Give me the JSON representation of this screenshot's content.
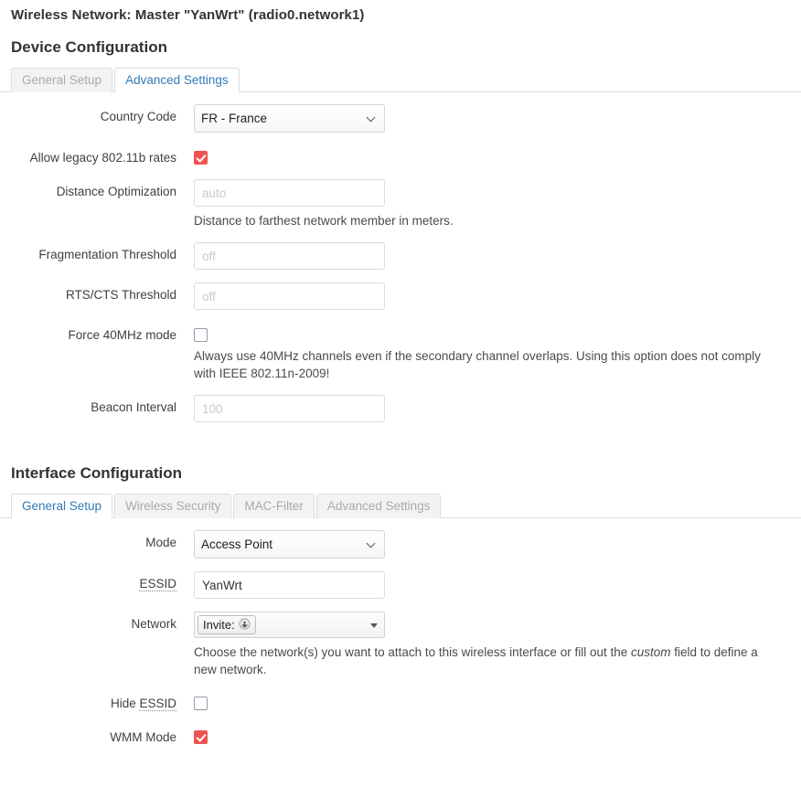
{
  "page": {
    "title": "Wireless Network: Master \"YanWrt\" (radio0.network1)"
  },
  "device_section": {
    "heading": "Device Configuration",
    "tabs": [
      {
        "label": "General Setup",
        "active": false
      },
      {
        "label": "Advanced Settings",
        "active": true
      }
    ],
    "fields": {
      "country_code": {
        "label": "Country Code",
        "value": "FR - France",
        "options": [
          "FR - France"
        ],
        "icon": "chevron-down-icon"
      },
      "legacy_rates": {
        "label": "Allow legacy 802.11b rates",
        "checked": true
      },
      "distance_optimization": {
        "label": "Distance Optimization",
        "value": "",
        "placeholder": "auto",
        "help": "Distance to farthest network member in meters."
      },
      "fragmentation_threshold": {
        "label": "Fragmentation Threshold",
        "value": "",
        "placeholder": "off"
      },
      "rts_cts_threshold": {
        "label": "RTS/CTS Threshold",
        "value": "",
        "placeholder": "off"
      },
      "force_40mhz": {
        "label": "Force 40MHz mode",
        "checked": false,
        "help_part1": "Always use 40MHz channels even if the secondary channel overlaps. Using this option does not comply with IEEE 802.11n-2009!"
      },
      "beacon_interval": {
        "label": "Beacon Interval",
        "value": "",
        "placeholder": "100"
      }
    }
  },
  "interface_section": {
    "heading": "Interface Configuration",
    "tabs": [
      {
        "label": "General Setup",
        "active": true
      },
      {
        "label": "Wireless Security",
        "active": false
      },
      {
        "label": "MAC-Filter",
        "active": false
      },
      {
        "label": "Advanced Settings",
        "active": false
      }
    ],
    "fields": {
      "mode": {
        "label": "Mode",
        "value": "Access Point",
        "options": [
          "Access Point"
        ],
        "icon": "chevron-down-icon"
      },
      "essid": {
        "label": "ESSID",
        "label_abbr": "ESSID",
        "value": "YanWrt"
      },
      "network": {
        "label": "Network",
        "token_label": "Invite:",
        "token_icon": "wireless-network-icon",
        "dropdown_icon": "triangle-down-icon",
        "help_before": "Choose the network(s) you want to attach to this wireless interface or fill out the ",
        "help_em": "custom",
        "help_after": " field to define a new network."
      },
      "hide_essid": {
        "label_prefix": "Hide ",
        "label_abbr": "ESSID",
        "checked": false
      },
      "wmm_mode": {
        "label": "WMM Mode",
        "checked": true
      }
    }
  },
  "colors": {
    "accent_blue": "#337ab7",
    "checkbox_red": "#ef5350",
    "border_grey": "#dddddd",
    "tab_inactive_text": "#aaaaaa"
  }
}
